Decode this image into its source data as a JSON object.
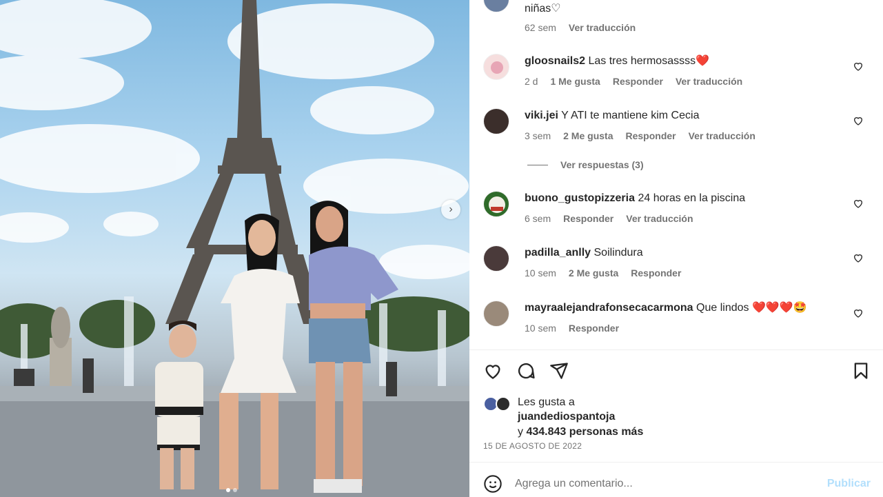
{
  "post": {
    "next_arrow": "›",
    "carousel_dots": 2,
    "carousel_active": 0
  },
  "comments": [
    {
      "user": "",
      "text": "niñas♡",
      "time": "62 sem",
      "likes": "",
      "reply": "",
      "translate": "Ver traducción",
      "avatar_color": "#6a7fa0"
    },
    {
      "user": "gloosnails2",
      "text": "Las tres hermosassss❤️",
      "time": "2 d",
      "likes": "1 Me gusta",
      "reply": "Responder",
      "translate": "Ver traducción",
      "avatar_color": "#f6dede"
    },
    {
      "user": "viki.jei",
      "text": "Y ATI te mantiene kim Cecia",
      "time": "3 sem",
      "likes": "2 Me gusta",
      "reply": "Responder",
      "translate": "Ver traducción",
      "avatar_color": "#3b2e2b"
    },
    {
      "user": "buono_gustopizzeria",
      "text": "24 horas en la piscina",
      "time": "6 sem",
      "likes": "",
      "reply": "Responder",
      "translate": "Ver traducción",
      "avatar_color": "#2f6b2a"
    },
    {
      "user": "padilla_anlly",
      "text": "Soilindura",
      "time": "10 sem",
      "likes": "2 Me gusta",
      "reply": "Responder",
      "translate": "",
      "avatar_color": "#4a3a3a"
    },
    {
      "user": "mayraalejandrafonsecacarmona",
      "text": "Que lindos ❤️❤️❤️🤩",
      "time": "10 sem",
      "likes": "",
      "reply": "Responder",
      "translate": "",
      "avatar_color": "#9a8a7a"
    }
  ],
  "view_replies": "Ver respuestas (3)",
  "actions": {
    "like_icon": "heart-icon",
    "comment_icon": "comment-icon",
    "share_icon": "send-icon",
    "save_icon": "bookmark-icon"
  },
  "likes": {
    "line1": "Les gusta a",
    "user": "juandediospantoja",
    "prefix": "y",
    "count": "434.843 personas más"
  },
  "date": "15 DE AGOSTO DE 2022",
  "add_comment": {
    "placeholder": "Agrega un comentario...",
    "post_label": "Publicar"
  }
}
